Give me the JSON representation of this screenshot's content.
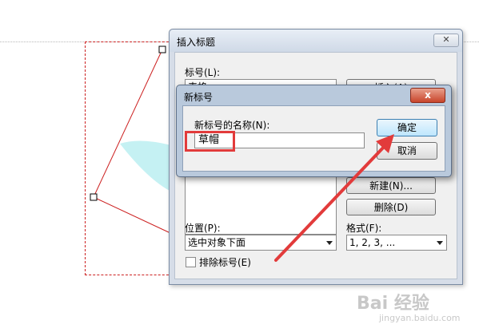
{
  "main_dialog": {
    "title": "插入标题",
    "close_glyph": "✕",
    "caption_label": "标号(L):",
    "caption_value": "表格",
    "insert_caption_button": "插入(A)",
    "new_label_button": "新建(N)...",
    "delete_label_button": "删除(D)",
    "position_label": "位置(P):",
    "position_value": "选中对象下面",
    "format_label": "格式(F):",
    "format_value": "1, 2, 3, ...",
    "exclude_label_checkbox": "排除标号(E)"
  },
  "new_label_dialog": {
    "title": "新标号",
    "close_glyph": "x",
    "name_label": "新标号的名称(N):",
    "name_value": "草帽",
    "ok_button": "确定",
    "cancel_button": "取消"
  },
  "watermark": {
    "brand": "Bai 经验",
    "url": "jingyan.baidu.com"
  },
  "colors": {
    "annotation": "#e23b3b",
    "dialog_frame": "#b9c9dc",
    "dialog_face": "#f0f0f0"
  }
}
